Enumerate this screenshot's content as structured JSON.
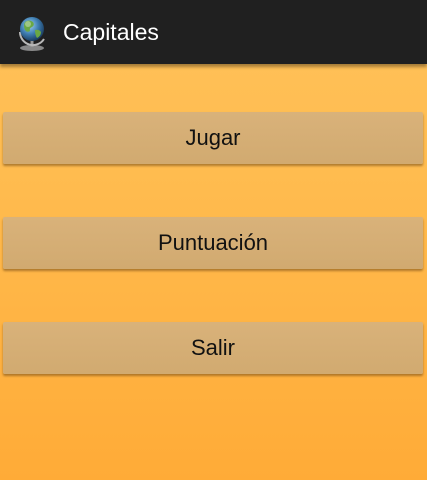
{
  "action_bar": {
    "title": "Capitales",
    "icon": "globe-icon"
  },
  "menu": {
    "buttons": [
      {
        "label": "Jugar"
      },
      {
        "label": "Puntuación"
      },
      {
        "label": "Salir"
      }
    ]
  },
  "colors": {
    "action_bar": "#202020",
    "background_top": "#ffc25a",
    "background_bottom": "#ffab37",
    "button": "#d5ae74"
  }
}
